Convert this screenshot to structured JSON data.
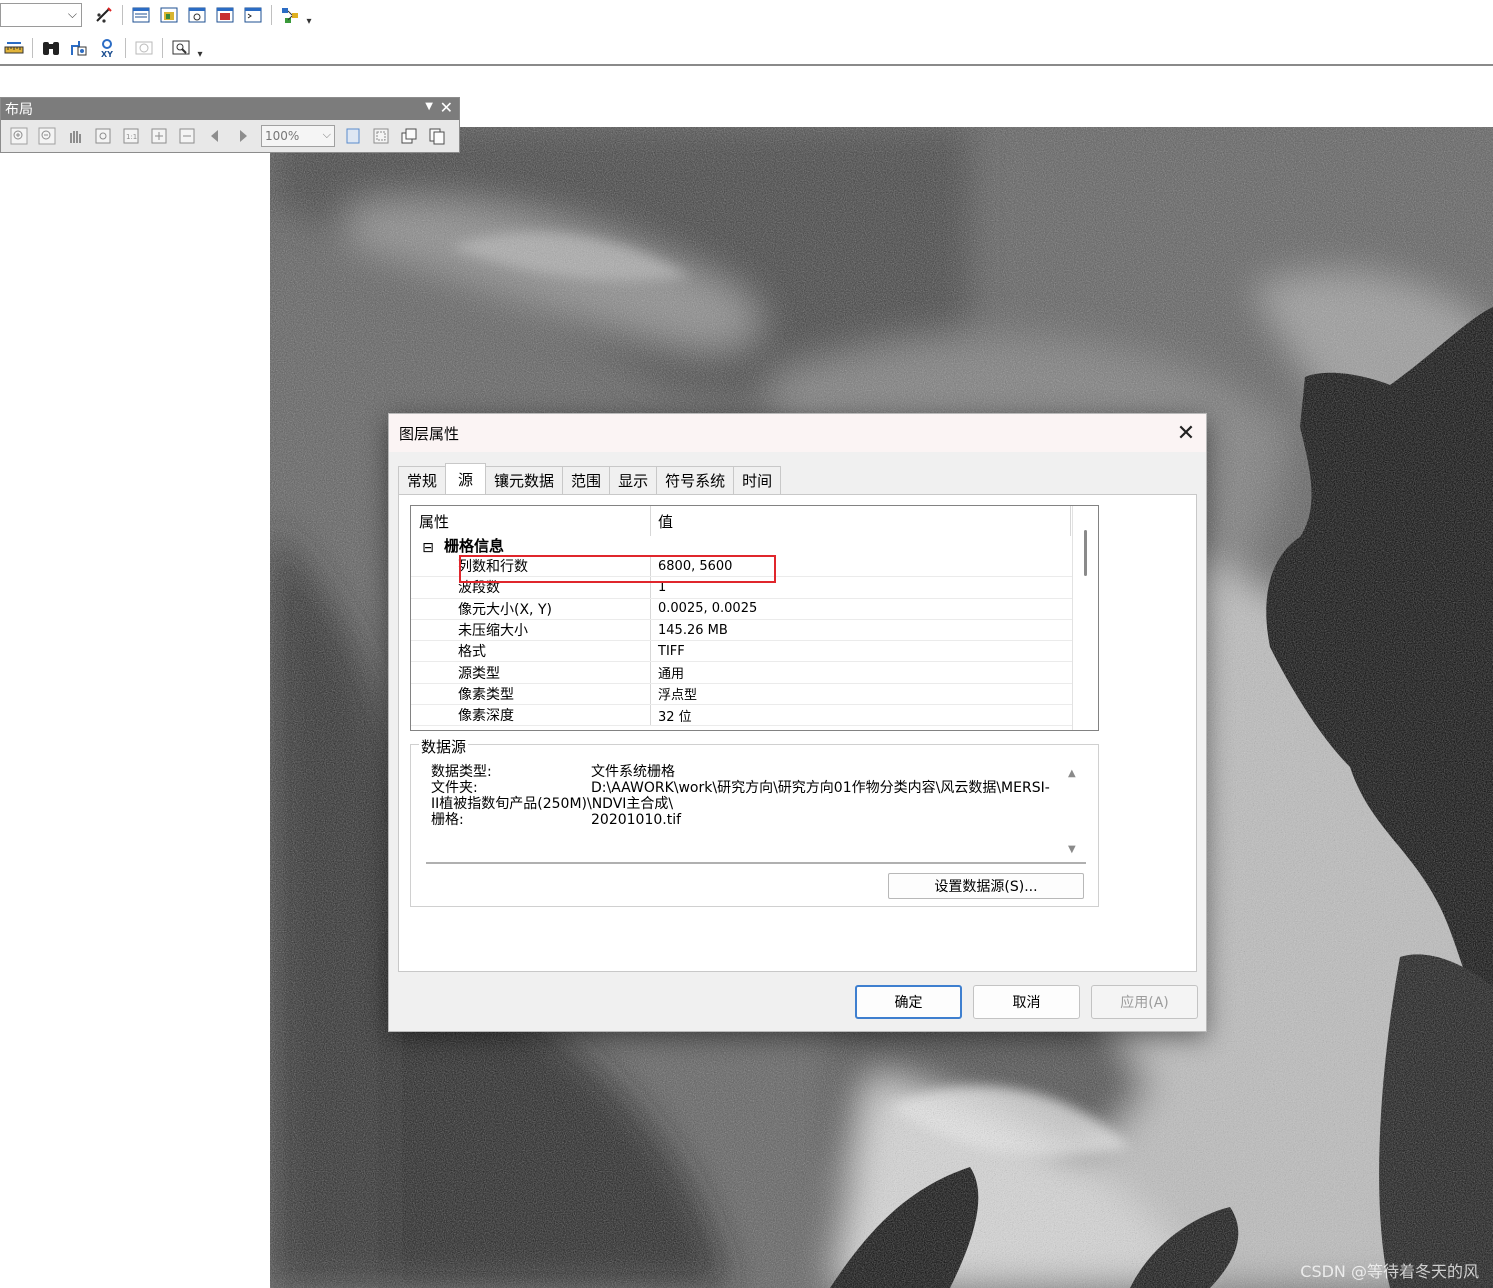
{
  "layout_toolbar": {
    "title": "布局",
    "zoom_value": "100%"
  },
  "dialog": {
    "title": "图层属性",
    "tabs": [
      {
        "label": "常规"
      },
      {
        "label": "源"
      },
      {
        "label": "镶元数据"
      },
      {
        "label": "范围"
      },
      {
        "label": "显示"
      },
      {
        "label": "符号系统"
      },
      {
        "label": "时间"
      }
    ],
    "active_tab": "源",
    "grid": {
      "col_property": "属性",
      "col_value": "值",
      "group_label": "栅格信息",
      "group_toggle": "⊟",
      "rows": [
        {
          "key": "列数和行数",
          "value": "6800, 5600"
        },
        {
          "key": "波段数",
          "value": "1"
        },
        {
          "key": "像元大小(X, Y)",
          "value": "0.0025, 0.0025"
        },
        {
          "key": "未压缩大小",
          "value": "145.26 MB"
        },
        {
          "key": "格式",
          "value": "TIFF"
        },
        {
          "key": "源类型",
          "value": "通用"
        },
        {
          "key": "像素类型",
          "value": "浮点型"
        },
        {
          "key": "像素深度",
          "value": "32 位"
        }
      ]
    },
    "datasource": {
      "legend": "数据源",
      "data_type_label": "数据类型:",
      "data_type_value": "文件系统栅格",
      "folder_label": "文件夹:",
      "folder_value_line1": "D:\\AAWORK\\work\\研究方向\\研究方向01作物分类内容\\风云数据\\MERSI-",
      "folder_value_line2": "II植被指数旬产品(250M)\\NDVI主合成\\",
      "raster_label": "栅格:",
      "raster_value": "20201010.tif",
      "set_source_button": "设置数据源(S)..."
    },
    "buttons": {
      "ok": "确定",
      "cancel": "取消",
      "apply": "应用(A)"
    }
  },
  "watermark": "CSDN @等待着冬天的风",
  "colors": {
    "highlight_box": "#e0262c",
    "ok_border": "#3e7fcf",
    "layout_titlebar": "#7c7c7c"
  }
}
